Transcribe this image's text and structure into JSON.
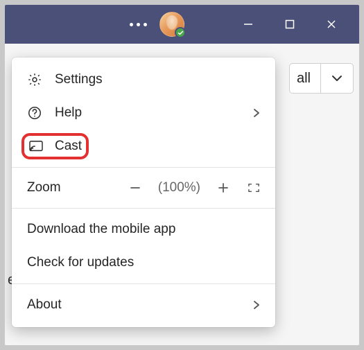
{
  "titlebar": {
    "more_label": "More options"
  },
  "background": {
    "call_label": "all",
    "stray_letter": "e"
  },
  "menu": {
    "settings_label": "Settings",
    "help_label": "Help",
    "cast_label": "Cast",
    "zoom_label": "Zoom",
    "zoom_pct": "(100%)",
    "download_label": "Download the mobile app",
    "updates_label": "Check for updates",
    "about_label": "About"
  }
}
